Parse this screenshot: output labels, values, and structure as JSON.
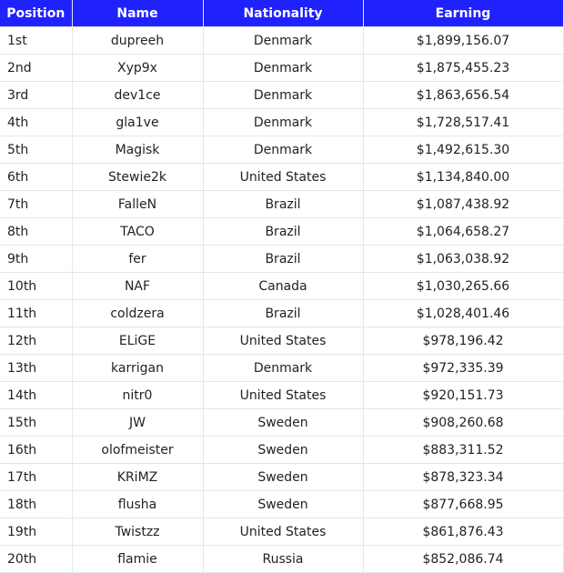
{
  "table": {
    "headers": [
      "Position",
      "Name",
      "Nationality",
      "Earning"
    ],
    "header_color": "#1f22ff",
    "rows": [
      {
        "position": "1st",
        "name": "dupreeh",
        "nationality": "Denmark",
        "earning": "$1,899,156.07"
      },
      {
        "position": "2nd",
        "name": "Xyp9x",
        "nationality": "Denmark",
        "earning": "$1,875,455.23"
      },
      {
        "position": "3rd",
        "name": "dev1ce",
        "nationality": "Denmark",
        "earning": "$1,863,656.54"
      },
      {
        "position": "4th",
        "name": "gla1ve",
        "nationality": "Denmark",
        "earning": "$1,728,517.41"
      },
      {
        "position": "5th",
        "name": "Magisk",
        "nationality": "Denmark",
        "earning": "$1,492,615.30"
      },
      {
        "position": "6th",
        "name": "Stewie2k",
        "nationality": "United States",
        "earning": "$1,134,840.00"
      },
      {
        "position": "7th",
        "name": "FalleN",
        "nationality": "Brazil",
        "earning": "$1,087,438.92"
      },
      {
        "position": "8th",
        "name": "TACO",
        "nationality": "Brazil",
        "earning": "$1,064,658.27"
      },
      {
        "position": "9th",
        "name": "fer",
        "nationality": "Brazil",
        "earning": "$1,063,038.92"
      },
      {
        "position": "10th",
        "name": "NAF",
        "nationality": "Canada",
        "earning": "$1,030,265.66"
      },
      {
        "position": "11th",
        "name": "coldzera",
        "nationality": "Brazil",
        "earning": "$1,028,401.46"
      },
      {
        "position": "12th",
        "name": "ELiGE",
        "nationality": "United States",
        "earning": "$978,196.42"
      },
      {
        "position": "13th",
        "name": "karrigan",
        "nationality": "Denmark",
        "earning": "$972,335.39"
      },
      {
        "position": "14th",
        "name": "nitr0",
        "nationality": "United States",
        "earning": "$920,151.73"
      },
      {
        "position": "15th",
        "name": "JW",
        "nationality": "Sweden",
        "earning": "$908,260.68"
      },
      {
        "position": "16th",
        "name": "olofmeister",
        "nationality": "Sweden",
        "earning": "$883,311.52"
      },
      {
        "position": "17th",
        "name": "KRiMZ",
        "nationality": "Sweden",
        "earning": "$878,323.34"
      },
      {
        "position": "18th",
        "name": "flusha",
        "nationality": "Sweden",
        "earning": "$877,668.95"
      },
      {
        "position": "19th",
        "name": "Twistzz",
        "nationality": "United States",
        "earning": "$861,876.43"
      },
      {
        "position": "20th",
        "name": "flamie",
        "nationality": "Russia",
        "earning": "$852,086.74"
      }
    ]
  }
}
